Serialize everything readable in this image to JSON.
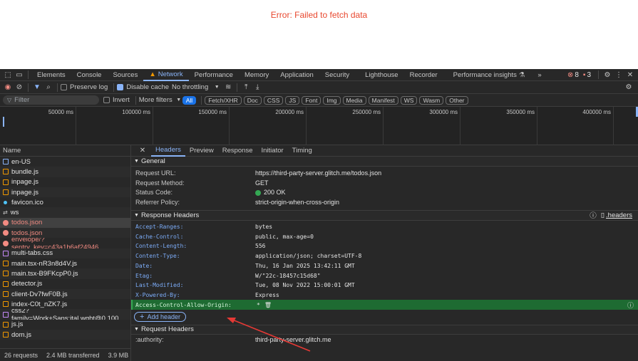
{
  "page": {
    "error_text": "Error: Failed to fetch data"
  },
  "panel_tabs": [
    "Elements",
    "Console",
    "Sources",
    "Network",
    "Performance",
    "Memory",
    "Application",
    "Security",
    "Lighthouse",
    "Recorder",
    "Performance insights"
  ],
  "panel_more": "»",
  "badges": {
    "errors": "8",
    "warnings": "3"
  },
  "toolbar": {
    "preserve_log": "Preserve log",
    "disable_cache": "Disable cache",
    "throttling": "No throttling"
  },
  "filter": {
    "placeholder": "Filter",
    "invert": "Invert",
    "more_filters": "More filters"
  },
  "type_filters": [
    "All",
    "Fetch/XHR",
    "Doc",
    "CSS",
    "JS",
    "Font",
    "Img",
    "Media",
    "Manifest",
    "WS",
    "Wasm",
    "Other"
  ],
  "timeline_ticks": [
    "50000 ms",
    "100000 ms",
    "150000 ms",
    "200000 ms",
    "250000 ms",
    "300000 ms",
    "350000 ms",
    "400000 ms"
  ],
  "requests": {
    "header": "Name",
    "items": [
      {
        "name": "en-US",
        "type": "doc"
      },
      {
        "name": "bundle.js",
        "type": "js"
      },
      {
        "name": "inpage.js",
        "type": "js"
      },
      {
        "name": "inpage.js",
        "type": "js"
      },
      {
        "name": "favicon.ico",
        "type": "fav"
      },
      {
        "name": "ws",
        "type": "ws"
      },
      {
        "name": "todos.json",
        "type": "err"
      },
      {
        "name": "todos.json",
        "type": "err"
      },
      {
        "name": "envelope/?sentry_key=c43a1b6af24946...",
        "type": "err"
      },
      {
        "name": "multi-tabs.css",
        "type": "css"
      },
      {
        "name": "main.tsx-nR3n8d4V.js",
        "type": "js"
      },
      {
        "name": "main.tsx-B9FKcpP0.js",
        "type": "js"
      },
      {
        "name": "detector.js",
        "type": "js"
      },
      {
        "name": "client-Dv7fwF0B.js",
        "type": "js"
      },
      {
        "name": "index-C0t_nZK7.js",
        "type": "js"
      },
      {
        "name": "css2?family=Work+Sans:ital,wght@0,100...",
        "type": "css"
      },
      {
        "name": "js.js",
        "type": "js"
      },
      {
        "name": "dom.js",
        "type": "js"
      }
    ],
    "footer": {
      "count": "26 requests",
      "transferred": "2.4 MB transferred",
      "resources": "3.9 MB r"
    }
  },
  "detail_tabs": [
    "Headers",
    "Preview",
    "Response",
    "Initiator",
    "Timing"
  ],
  "general": {
    "title": "General",
    "rows": [
      {
        "k": "Request URL:",
        "v": "https://third-party-server.glitch.me/todos.json"
      },
      {
        "k": "Request Method:",
        "v": "GET"
      },
      {
        "k": "Status Code:",
        "v": "200 OK"
      },
      {
        "k": "Referrer Policy:",
        "v": "strict-origin-when-cross-origin"
      }
    ]
  },
  "response_headers": {
    "title": "Response Headers",
    "link": ".headers",
    "rows": [
      {
        "k": "Accept-Ranges:",
        "v": "bytes"
      },
      {
        "k": "Cache-Control:",
        "v": "public, max-age=0"
      },
      {
        "k": "Content-Length:",
        "v": "556"
      },
      {
        "k": "Content-Type:",
        "v": "application/json; charset=UTF-8"
      },
      {
        "k": "Date:",
        "v": "Thu, 16 Jan 2025 13:42:11 GMT"
      },
      {
        "k": "Etag:",
        "v": "W/\"22c-18457c15d68\""
      },
      {
        "k": "Last-Modified:",
        "v": "Tue, 08 Nov 2022 15:00:01 GMT"
      },
      {
        "k": "X-Powered-By:",
        "v": "Express"
      },
      {
        "k": "Access-Control-Allow-Origin:",
        "v": "*"
      }
    ],
    "add_header": "Add header"
  },
  "request_headers": {
    "title": "Request Headers",
    "rows": [
      {
        "k": ":authority:",
        "v": "third-party-server.glitch.me"
      }
    ]
  },
  "colors": {
    "accent": "#8ab4f8",
    "error": "#f28b82",
    "highlight": "#1e6b32",
    "arrow": "#e53935"
  }
}
